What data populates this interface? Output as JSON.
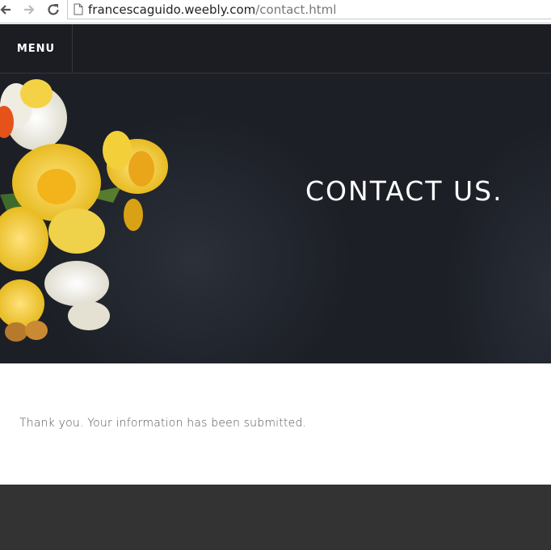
{
  "browser": {
    "url_host": "francescaguido.weebly.com",
    "url_path": "/contact.html",
    "back_icon": "arrow-left",
    "forward_icon": "arrow-right",
    "reload_icon": "reload",
    "page_icon": "page"
  },
  "header": {
    "menu_label": "MENU"
  },
  "hero": {
    "title": "CONTACT US."
  },
  "main": {
    "confirmation_text": "Thank you. Your information has been submitted."
  },
  "colors": {
    "header_bg": "#1b1d22",
    "hero_bg": "#1c1f26",
    "footer_bg": "#333333",
    "text_muted": "#555555"
  }
}
